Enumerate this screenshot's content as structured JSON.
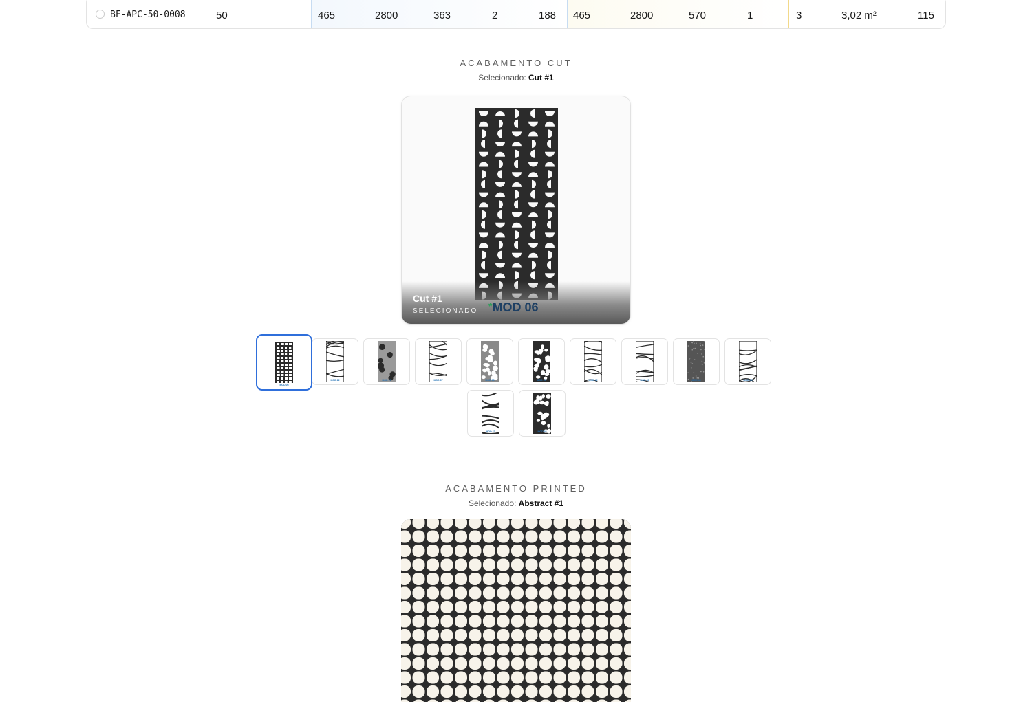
{
  "row": {
    "code": "BF-APC-50-0008",
    "thickness": "50",
    "group1": [
      "465",
      "2800",
      "363",
      "2",
      "188"
    ],
    "group2": [
      "465",
      "2800",
      "570",
      "1"
    ],
    "qty": "3",
    "area": "3,02 m²",
    "last": "115"
  },
  "cut": {
    "title": "ACABAMENTO CUT",
    "selected_label": "Selecionado:",
    "selected_value": "Cut #1",
    "hero_name": "Cut #1",
    "hero_state": "SELECIONADO",
    "hero_mod": "MOD 06",
    "hero_mod_prefix": "*",
    "thumbnails": [
      {
        "mod": "MOD 06",
        "pattern": "grid"
      },
      {
        "mod": "MOD 22",
        "pattern": "leaf"
      },
      {
        "mod": "MOD 27",
        "pattern": "blob"
      },
      {
        "mod": "MOD 37",
        "pattern": "lines"
      },
      {
        "mod": "MOD 35",
        "pattern": "hex"
      },
      {
        "mod": "MOD 40",
        "pattern": "stone"
      },
      {
        "mod": "MOD 42",
        "pattern": "wave"
      },
      {
        "mod": "MOD 43",
        "pattern": "floral"
      },
      {
        "mod": "MOD 44",
        "pattern": "dots"
      },
      {
        "mod": "MOD 45",
        "pattern": "swirl"
      },
      {
        "mod": "MOD 47",
        "pattern": "zebra"
      },
      {
        "mod": "MOD 36",
        "pattern": "cells"
      }
    ]
  },
  "printed": {
    "title": "ACABAMENTO PRINTED",
    "selected_label": "Selecionado:",
    "selected_value": "Abstract #1"
  },
  "colors": {
    "accent": "#2f6fdb",
    "panel": "#2b2b2b",
    "mod_text": "#1d3f63"
  }
}
